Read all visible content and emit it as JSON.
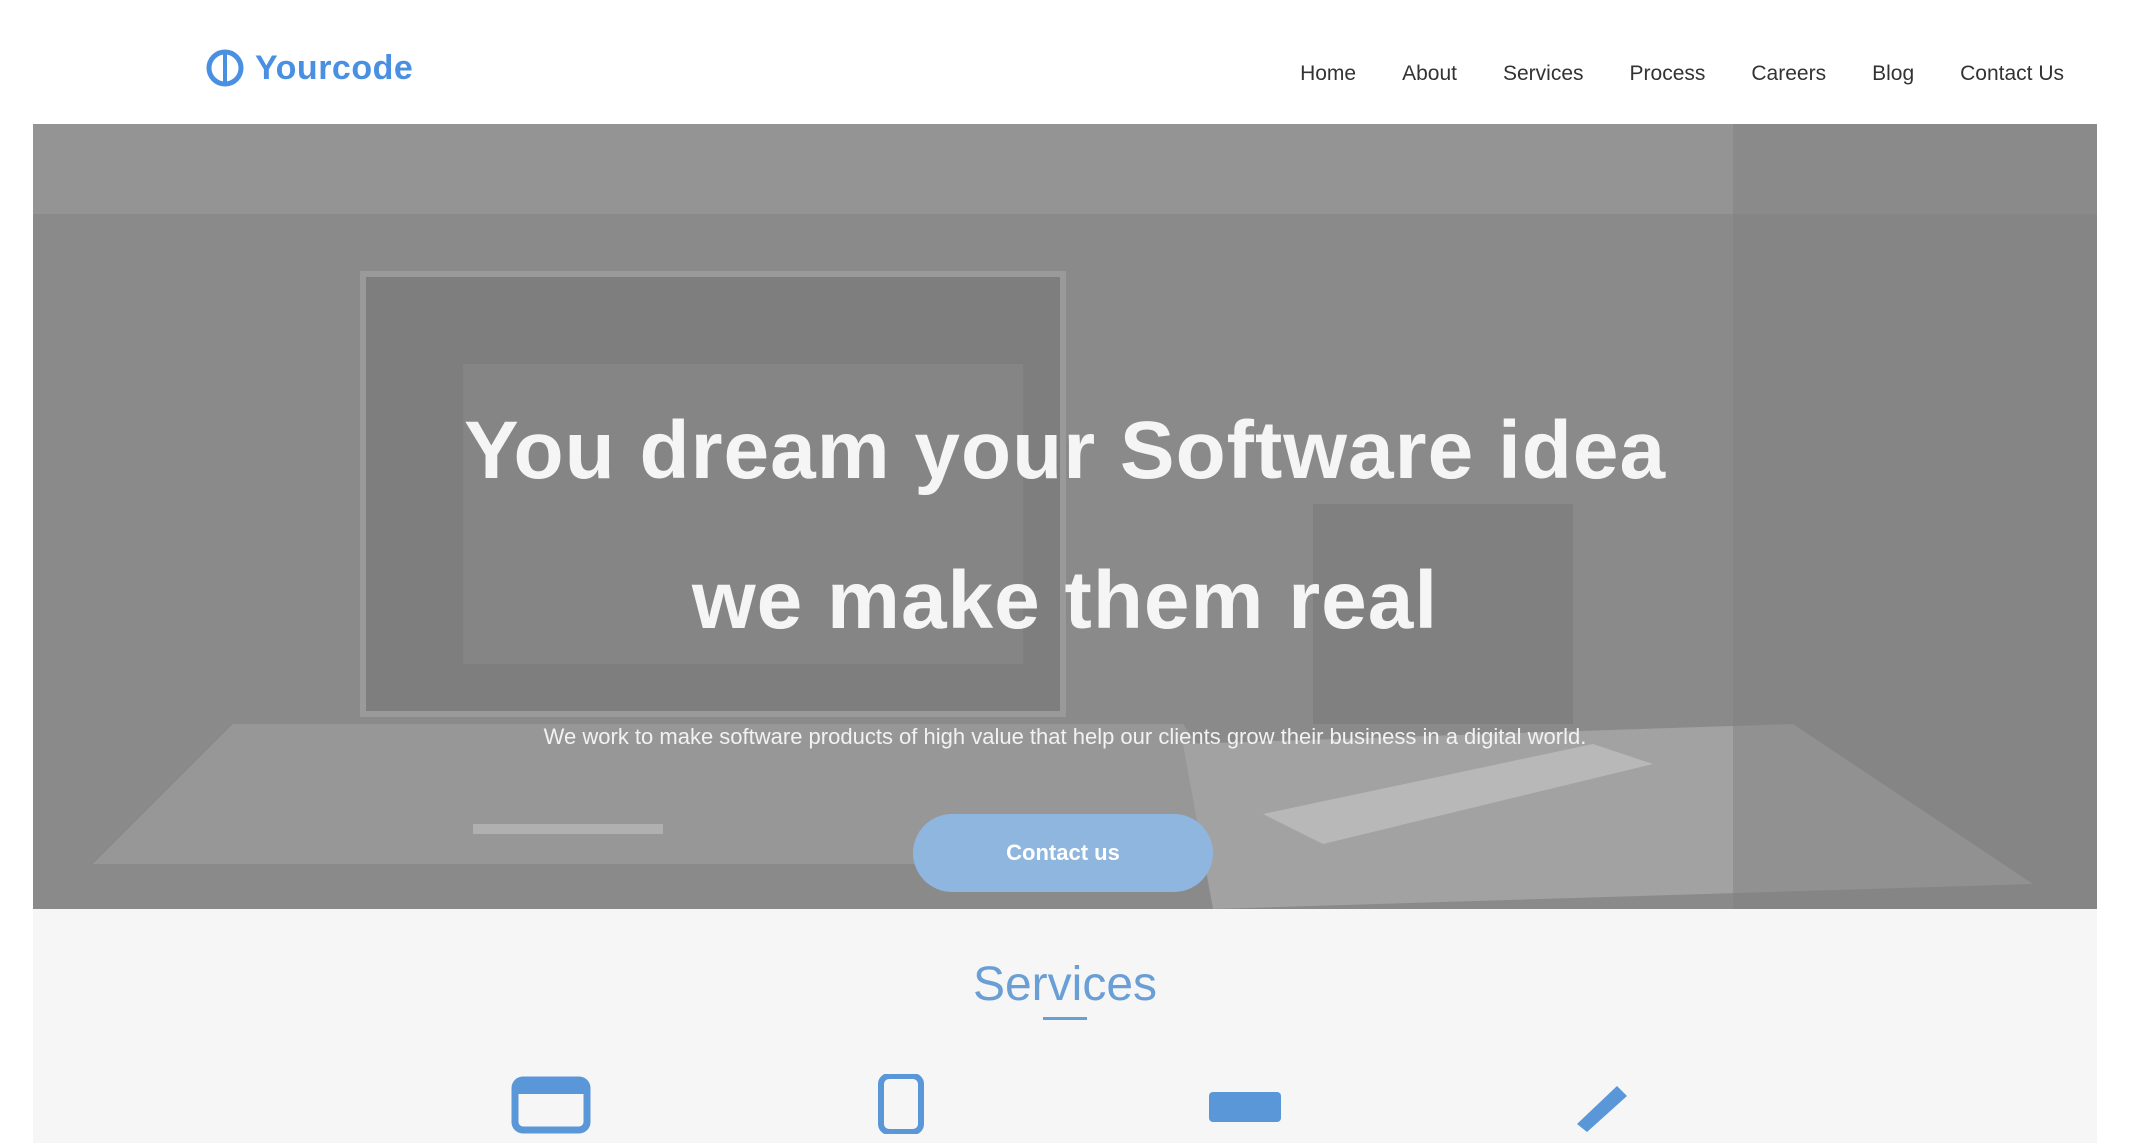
{
  "brand": {
    "name": "Yourcode",
    "accent_color": "#4a90e2"
  },
  "nav": {
    "items": [
      "Home",
      "About",
      "Services",
      "Process",
      "Careers",
      "Blog",
      "Contact Us"
    ]
  },
  "hero": {
    "title_line_1": "You dream your Software idea",
    "title_line_2": "we make them real",
    "subtitle": "We work to make software products of high value that help our clients grow their business in a digital world.",
    "cta_label": "Contact us"
  },
  "services": {
    "title": "Services",
    "icons": [
      "web-development-icon",
      "mobile-app-icon",
      "video-icon",
      "design-icon"
    ]
  }
}
